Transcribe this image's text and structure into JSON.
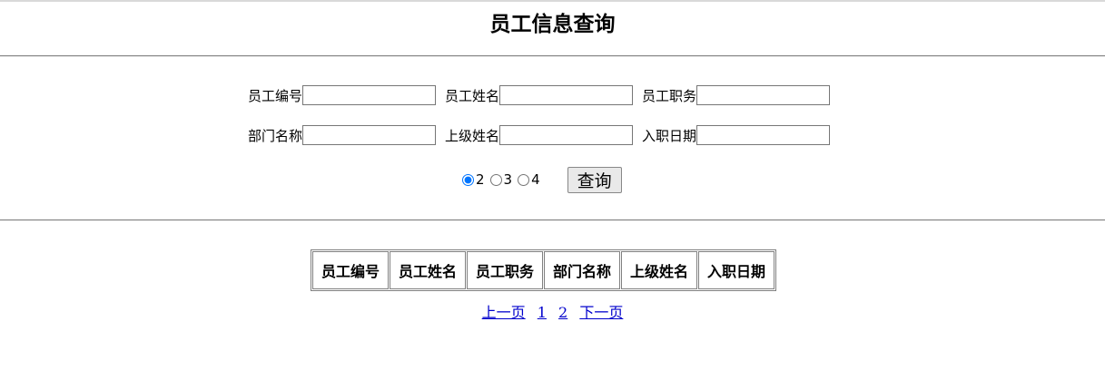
{
  "page": {
    "title": "员工信息查询"
  },
  "form": {
    "fields_row1": [
      {
        "label": "员工编号",
        "value": ""
      },
      {
        "label": "员工姓名",
        "value": ""
      },
      {
        "label": "员工职务",
        "value": ""
      }
    ],
    "fields_row2": [
      {
        "label": "部门名称",
        "value": ""
      },
      {
        "label": "上级姓名",
        "value": ""
      },
      {
        "label": "入职日期",
        "value": ""
      }
    ],
    "radios": [
      {
        "label": "2",
        "checked": true
      },
      {
        "label": "3",
        "checked": false
      },
      {
        "label": "4",
        "checked": false
      }
    ],
    "query_label": "查询"
  },
  "table": {
    "columns": [
      "员工编号",
      "员工姓名",
      "员工职务",
      "部门名称",
      "上级姓名",
      "入职日期"
    ]
  },
  "pager": {
    "prev_label": "上一页",
    "pages": [
      "1",
      "2"
    ],
    "next_label": "下一页"
  }
}
